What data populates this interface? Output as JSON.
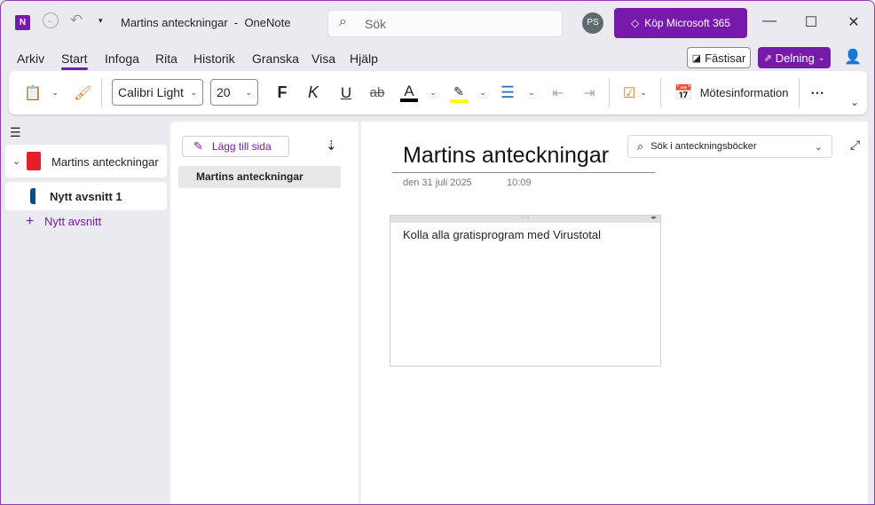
{
  "titlebar": {
    "title": "Martins anteckningar  -  OneNote",
    "search_placeholder": "Sök",
    "avatar": "PS",
    "buy": "Köp Microsoft 365"
  },
  "menu": [
    "Arkiv",
    "Start",
    "Infoga",
    "Rita",
    "Historik",
    "Granska",
    "Visa",
    "Hjälp"
  ],
  "menu_right": {
    "sticky": "Fästisar",
    "share": "Delning"
  },
  "ribbon": {
    "font": "Calibri Light",
    "size": "20",
    "bold": "F",
    "italic": "K",
    "underline": "U",
    "strike": "ab",
    "fontcolor": "A",
    "meeting": "Mötesinformation",
    "more": "•••"
  },
  "colors": {
    "accent": "#7719aa",
    "highlight": "#ffff00"
  },
  "sidebar": {
    "notebook": "Martins anteckningar",
    "section": "Nytt avsnitt 1",
    "add_section": "Nytt avsnitt"
  },
  "pages": {
    "add_page": "Lägg till sida",
    "items": [
      "Martins anteckningar"
    ]
  },
  "page": {
    "title": "Martins anteckningar",
    "date": "den 31 juli 2025",
    "time": "10:09",
    "note": "Kolla alla gratisprogram med Virustotal",
    "search_placeholder": "Sök i anteckningsböcker"
  }
}
